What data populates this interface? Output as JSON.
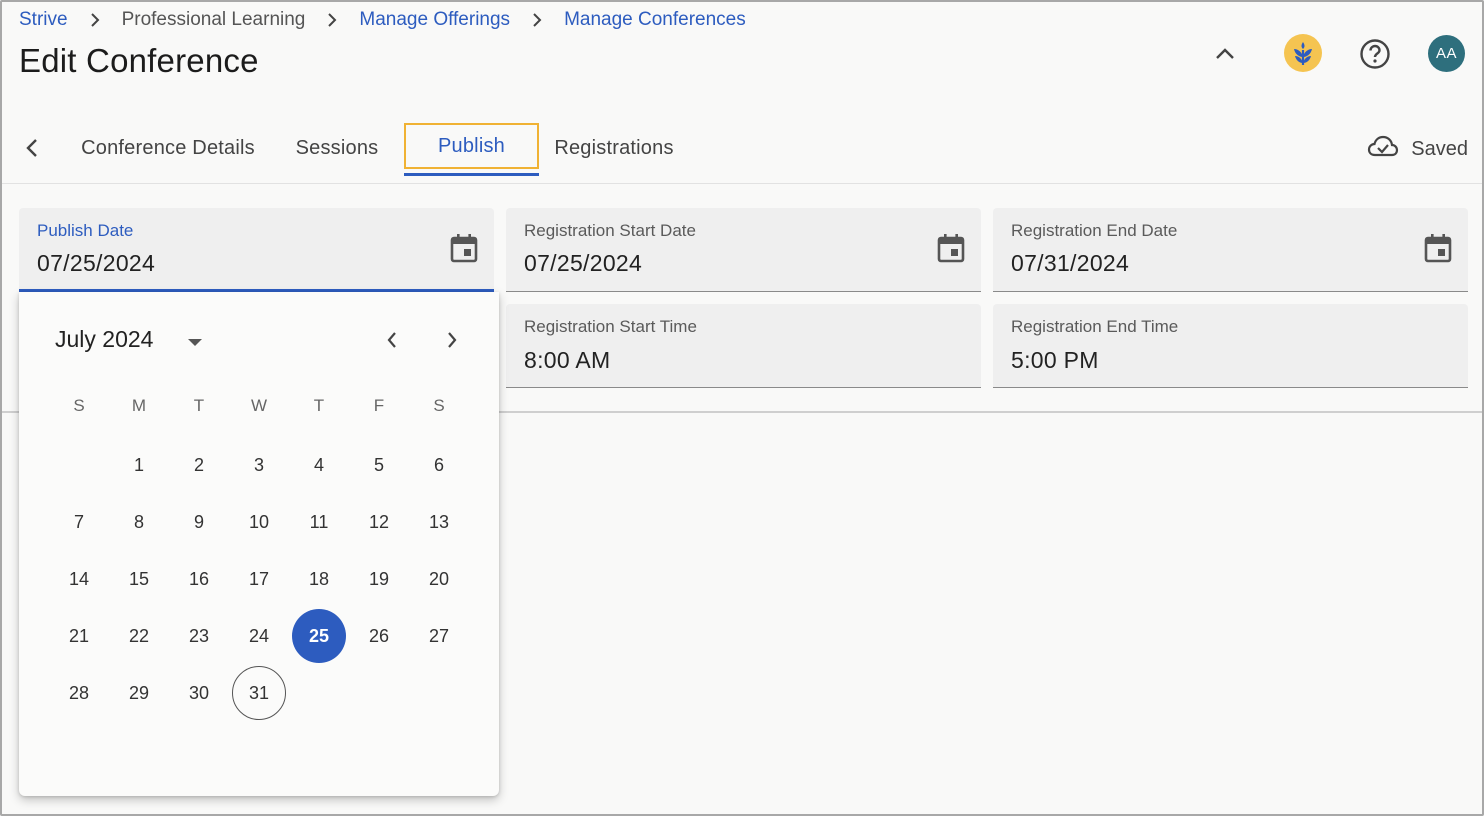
{
  "breadcrumb": {
    "items": [
      "Strive",
      "Professional Learning",
      "Manage Offerings",
      "Manage Conferences"
    ]
  },
  "page": {
    "title": "Edit Conference"
  },
  "header": {
    "avatar_initials": "AA",
    "brand_color": "#f5c451",
    "avatar_color": "#2e6f7d"
  },
  "tabs": {
    "items": [
      "Conference Details",
      "Sessions",
      "Publish",
      "Registrations"
    ],
    "active": "Publish",
    "status": "Saved"
  },
  "fields": {
    "publish_date": {
      "label": "Publish Date",
      "value": "07/25/2024"
    },
    "registration_start_date": {
      "label": "Registration Start Date",
      "value": "07/25/2024"
    },
    "registration_end_date": {
      "label": "Registration End Date",
      "value": "07/31/2024"
    },
    "registration_start_time": {
      "label": "Registration Start Time",
      "value": "8:00 AM"
    },
    "registration_end_time": {
      "label": "Registration End Time",
      "value": "5:00 PM"
    }
  },
  "calendar": {
    "month_label": "July 2024",
    "weekdays": [
      "S",
      "M",
      "T",
      "W",
      "T",
      "F",
      "S"
    ],
    "days": [
      [
        "",
        "1",
        "2",
        "3",
        "4",
        "5",
        "6"
      ],
      [
        "7",
        "8",
        "9",
        "10",
        "11",
        "12",
        "13"
      ],
      [
        "14",
        "15",
        "16",
        "17",
        "18",
        "19",
        "20"
      ],
      [
        "21",
        "22",
        "23",
        "24",
        "25",
        "26",
        "27"
      ],
      [
        "28",
        "29",
        "30",
        "31",
        "",
        "",
        ""
      ]
    ],
    "selected_day": "25",
    "today": "31"
  },
  "colors": {
    "accent": "#2d5cbf",
    "focus_outline": "#f0b234"
  },
  "icons": [
    "chevron-right-icon",
    "chevron-up-icon",
    "brand-logo-icon",
    "help-icon",
    "chevron-left-icon",
    "cloud-check-icon",
    "calendar-icon",
    "dropdown-arrow-icon"
  ]
}
